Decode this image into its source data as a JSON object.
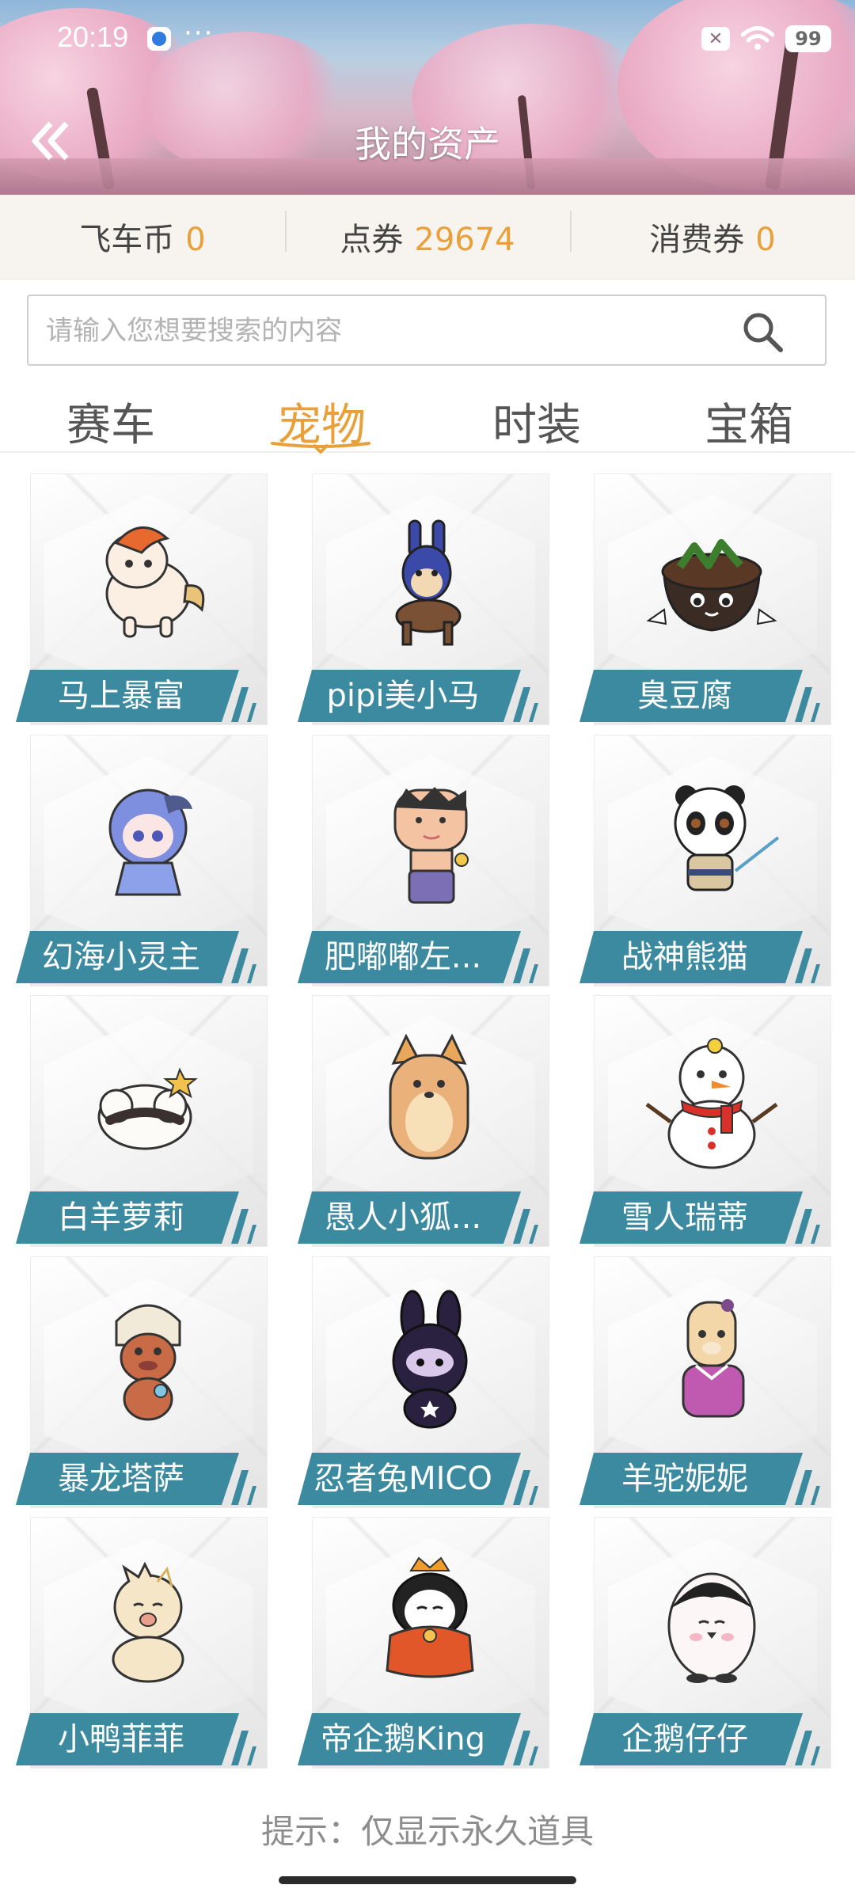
{
  "status_bar": {
    "time": "20:19",
    "more_dots": "···",
    "sim_label": "✕",
    "battery": "99"
  },
  "header": {
    "title": "我的资产",
    "back_icon": "double-chevron-left-icon"
  },
  "currencies": [
    {
      "label": "飞车币",
      "value": "0"
    },
    {
      "label": "点券",
      "value": "29674"
    },
    {
      "label": "消费券",
      "value": "0"
    }
  ],
  "search": {
    "placeholder": "请输入您想要搜索的内容",
    "value": "",
    "icon": "search-icon"
  },
  "tabs": [
    {
      "label": "赛车",
      "active": false
    },
    {
      "label": "宠物",
      "active": true
    },
    {
      "label": "时装",
      "active": false
    },
    {
      "label": "宝箱",
      "active": false
    }
  ],
  "pets": [
    {
      "name": "马上暴富",
      "art": "pony-icon"
    },
    {
      "name": "pipi美小马",
      "art": "donkey-icon"
    },
    {
      "name": "臭豆腐",
      "art": "stinky-tofu-icon"
    },
    {
      "name": "幻海小灵主",
      "art": "blue-girl-icon"
    },
    {
      "name": "肥嘟嘟左...",
      "art": "cartoon-boy-icon"
    },
    {
      "name": "战神熊猫",
      "art": "panda-warrior-icon"
    },
    {
      "name": "白羊萝莉",
      "art": "sheep-icon"
    },
    {
      "name": "愚人小狐...",
      "art": "fox-icon"
    },
    {
      "name": "雪人瑞蒂",
      "art": "snowman-icon"
    },
    {
      "name": "暴龙塔萨",
      "art": "baby-dino-icon"
    },
    {
      "name": "忍者兔MICO",
      "art": "ninja-rabbit-icon"
    },
    {
      "name": "羊驼妮妮",
      "art": "alpaca-icon"
    },
    {
      "name": "小鸭菲菲",
      "art": "duckling-icon"
    },
    {
      "name": "帝企鹅King",
      "art": "king-penguin-icon"
    },
    {
      "name": "企鹅仔仔",
      "art": "penguin-chick-icon"
    }
  ],
  "footer": {
    "hint": "提示：仅显示永久道具"
  },
  "colors": {
    "accent": "#e9a03a",
    "label_bg": "#3c8aa0",
    "tab_text": "#555555"
  }
}
